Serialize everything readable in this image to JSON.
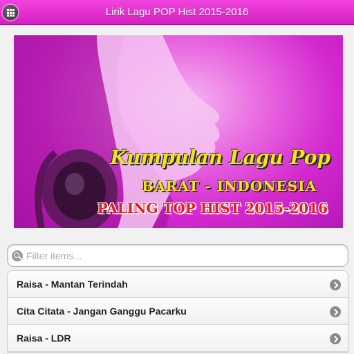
{
  "header": {
    "title": "Lirik Lagu POP Hist 2015-2016",
    "menu_icon": "grid-menu-icon"
  },
  "banner": {
    "line1": "Kumpulan Lagu Pop",
    "line2": "BARAT - INDONESIA",
    "line3": "PALING TOP HIST 2015-2016",
    "accent_color": "#d42ad0"
  },
  "search": {
    "placeholder": "Filter items..."
  },
  "list": {
    "items": [
      {
        "label": "Raisa - Mantan Terindah"
      },
      {
        "label": "Cita Citata - Jangan Ganggu Pacarku"
      },
      {
        "label": "Raisa - LDR"
      }
    ]
  },
  "colors": {
    "header": "#e231cf",
    "background": "#f1f1f1"
  }
}
